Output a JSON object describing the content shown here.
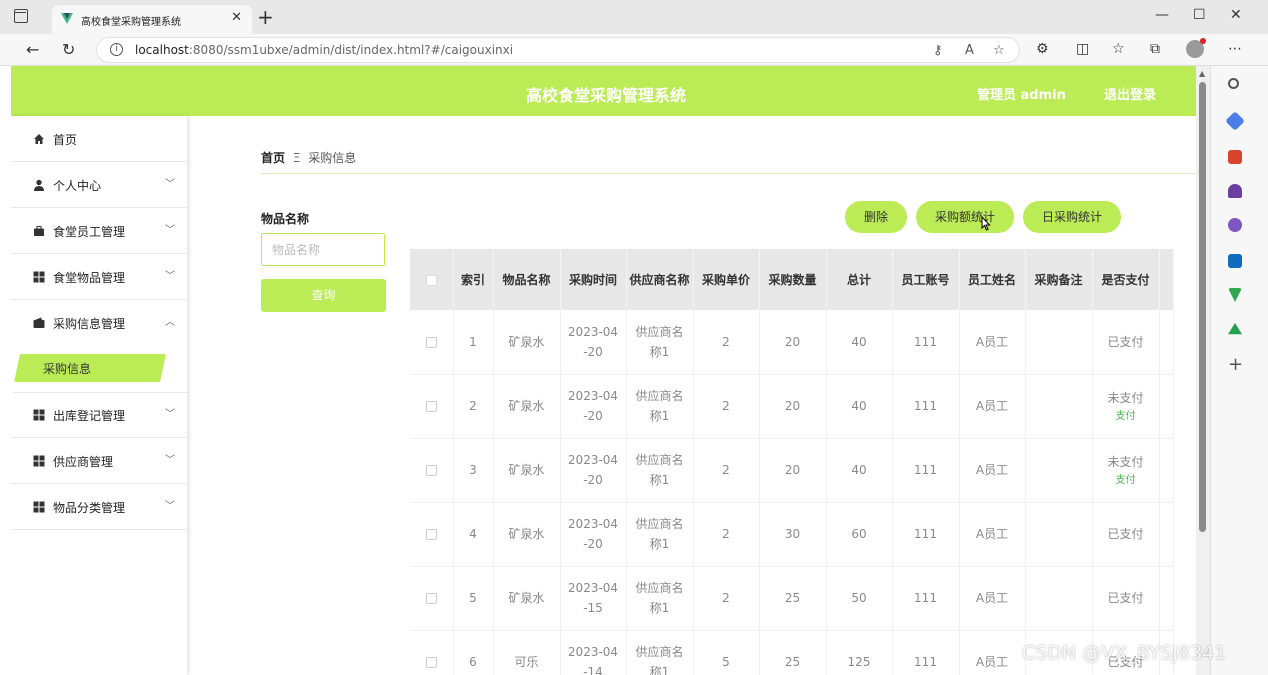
{
  "browser": {
    "tab_title": "高校食堂采购管理系统",
    "url_host": "localhost",
    "url_rest": ":8080/ssm1ubxe/admin/dist/index.html?#/caigouxinxi"
  },
  "header": {
    "title": "高校食堂采购管理系统",
    "admin_label": "管理员 admin",
    "logout_label": "退出登录"
  },
  "sidebar": {
    "items": [
      {
        "label": "首页",
        "icon": "home-icon"
      },
      {
        "label": "个人中心",
        "icon": "user-icon"
      },
      {
        "label": "食堂员工管理",
        "icon": "briefcase-icon"
      },
      {
        "label": "食堂物品管理",
        "icon": "grid-icon"
      },
      {
        "label": "采购信息管理",
        "icon": "wallet-icon"
      },
      {
        "label": "出库登记管理",
        "icon": "grid-icon"
      },
      {
        "label": "供应商管理",
        "icon": "grid-icon"
      },
      {
        "label": "物品分类管理",
        "icon": "grid-icon"
      }
    ],
    "sub_item": "采购信息"
  },
  "breadcrumb": {
    "home": "首页",
    "separator": "Ξ",
    "current": "采购信息"
  },
  "search": {
    "label": "物品名称",
    "placeholder": "物品名称",
    "button": "查询"
  },
  "actions": {
    "delete": "删除",
    "amount_stats": "采购额统计",
    "daily_stats": "日采购统计"
  },
  "table": {
    "headers": [
      "索引",
      "物品名称",
      "采购时间",
      "供应商名称",
      "采购单价",
      "采购数量",
      "总计",
      "员工账号",
      "员工姓名",
      "采购备注",
      "是否支付"
    ],
    "rows": [
      {
        "index": "1",
        "item": "矿泉水",
        "date_a": "2023-04",
        "date_b": "-20",
        "supplier_a": "供应商名",
        "supplier_b": "称1",
        "price": "2",
        "qty": "20",
        "total": "40",
        "account": "111",
        "name": "A员工",
        "note": "",
        "paid": "已支付",
        "pay_action": ""
      },
      {
        "index": "2",
        "item": "矿泉水",
        "date_a": "2023-04",
        "date_b": "-20",
        "supplier_a": "供应商名",
        "supplier_b": "称1",
        "price": "2",
        "qty": "20",
        "total": "40",
        "account": "111",
        "name": "A员工",
        "note": "",
        "paid": "未支付",
        "pay_action": "支付"
      },
      {
        "index": "3",
        "item": "矿泉水",
        "date_a": "2023-04",
        "date_b": "-20",
        "supplier_a": "供应商名",
        "supplier_b": "称1",
        "price": "2",
        "qty": "20",
        "total": "40",
        "account": "111",
        "name": "A员工",
        "note": "",
        "paid": "未支付",
        "pay_action": "支付"
      },
      {
        "index": "4",
        "item": "矿泉水",
        "date_a": "2023-04",
        "date_b": "-20",
        "supplier_a": "供应商名",
        "supplier_b": "称1",
        "price": "2",
        "qty": "30",
        "total": "60",
        "account": "111",
        "name": "A员工",
        "note": "",
        "paid": "已支付",
        "pay_action": ""
      },
      {
        "index": "5",
        "item": "矿泉水",
        "date_a": "2023-04",
        "date_b": "-15",
        "supplier_a": "供应商名",
        "supplier_b": "称1",
        "price": "2",
        "qty": "25",
        "total": "50",
        "account": "111",
        "name": "A员工",
        "note": "",
        "paid": "已支付",
        "pay_action": ""
      },
      {
        "index": "6",
        "item": "可乐",
        "date_a": "2023-04",
        "date_b": "-14",
        "supplier_a": "供应商名",
        "supplier_b": "称1",
        "price": "5",
        "qty": "25",
        "total": "125",
        "account": "111",
        "name": "A员工",
        "note": "",
        "paid": "已支付",
        "pay_action": ""
      }
    ]
  },
  "watermark": "CSDN @VX_BYSJ8341",
  "colors": {
    "accent": "#bbeb55",
    "table_header": "#e8e8e8",
    "pay_link": "#49b24a"
  }
}
